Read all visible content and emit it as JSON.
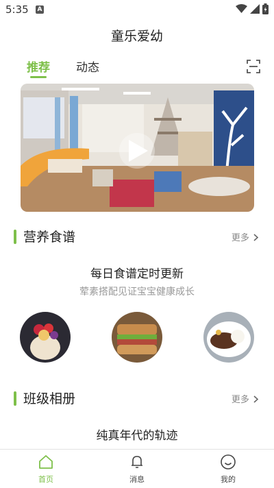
{
  "status_bar": {
    "time": "5:35",
    "notification_badge": "A"
  },
  "app": {
    "title": "童乐爱幼"
  },
  "tabs": [
    {
      "label": "推荐",
      "active": true
    },
    {
      "label": "动态",
      "active": false
    }
  ],
  "banner": {
    "type": "video",
    "icon": "play-icon"
  },
  "sections": {
    "recipes": {
      "title": "营养食谱",
      "more_label": "更多",
      "headline": "每日食谱定时更新",
      "subline": "荤素搭配见证宝宝健康成长",
      "items": [
        "dessert-cup",
        "sandwich",
        "meat-rice-plate"
      ]
    },
    "album": {
      "title": "班级相册",
      "more_label": "更多",
      "headline": "纯真年代的轨迹"
    }
  },
  "bottom_nav": [
    {
      "label": "首页",
      "icon": "home-icon",
      "active": true
    },
    {
      "label": "消息",
      "icon": "bell-icon",
      "active": false
    },
    {
      "label": "我的",
      "icon": "profile-icon",
      "active": false
    }
  ],
  "colors": {
    "accent": "#7ec04a",
    "text": "#222222",
    "muted": "#999999"
  }
}
